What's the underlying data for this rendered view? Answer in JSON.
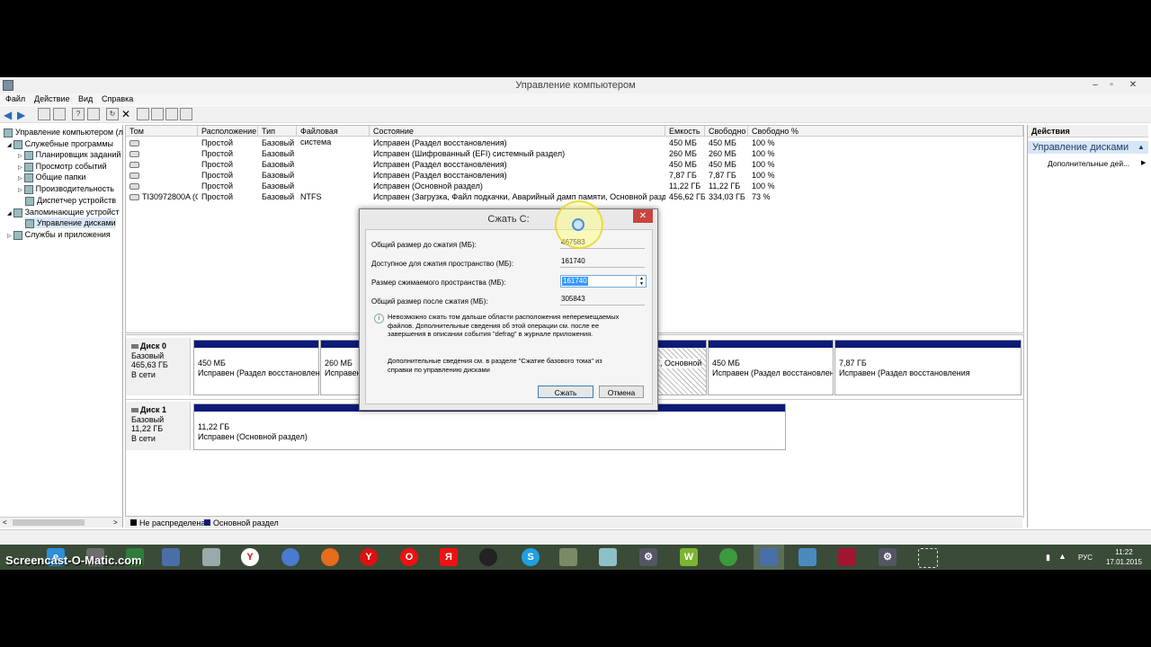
{
  "window": {
    "title": "Управление компьютером",
    "controls": [
      "–",
      "▫",
      "✕"
    ]
  },
  "menu": [
    "Файл",
    "Действие",
    "Вид",
    "Справка"
  ],
  "tree": [
    {
      "label": "Управление компьютером (л",
      "indent": 0,
      "expander": ""
    },
    {
      "label": "Служебные программы",
      "indent": 1,
      "expander": "◢"
    },
    {
      "label": "Планировщик заданий",
      "indent": 2,
      "expander": "▷"
    },
    {
      "label": "Просмотр событий",
      "indent": 2,
      "expander": "▷"
    },
    {
      "label": "Общие папки",
      "indent": 2,
      "expander": "▷"
    },
    {
      "label": "Производительность",
      "indent": 2,
      "expander": "▷"
    },
    {
      "label": "Диспетчер устройств",
      "indent": 2,
      "expander": ""
    },
    {
      "label": "Запоминающие устройст",
      "indent": 1,
      "expander": "◢"
    },
    {
      "label": "Управление дисками",
      "indent": 2,
      "expander": ""
    },
    {
      "label": "Службы и приложения",
      "indent": 1,
      "expander": "▷"
    }
  ],
  "volumes": {
    "columns": [
      "Том",
      "Расположение",
      "Тип",
      "Файловая система",
      "Состояние",
      "Емкость",
      "Свободно",
      "Свободно %"
    ],
    "rows": [
      [
        "",
        "Простой",
        "Базовый",
        "",
        "Исправен (Раздел восстановления)",
        "450 МБ",
        "450 МБ",
        "100 %"
      ],
      [
        "",
        "Простой",
        "Базовый",
        "",
        "Исправен (Шифрованный (EFI) системный раздел)",
        "260 МБ",
        "260 МБ",
        "100 %"
      ],
      [
        "",
        "Простой",
        "Базовый",
        "",
        "Исправен (Раздел восстановления)",
        "450 МБ",
        "450 МБ",
        "100 %"
      ],
      [
        "",
        "Простой",
        "Базовый",
        "",
        "Исправен (Раздел восстановления)",
        "7,87 ГБ",
        "7,87 ГБ",
        "100 %"
      ],
      [
        "",
        "Простой",
        "Базовый",
        "",
        "Исправен (Основной раздел)",
        "11,22 ГБ",
        "11,22 ГБ",
        "100 %"
      ],
      [
        "TI30972800A (C:)",
        "Простой",
        "Базовый",
        "NTFS",
        "Исправен (Загрузка, Файл подкачки, Аварийный дамп памяти, Основной раздел)",
        "456,62 ГБ",
        "334,03 ГБ",
        "73 %"
      ]
    ]
  },
  "disks": [
    {
      "name": "Диск 0",
      "type": "Базовый",
      "size": "465,63 ГБ",
      "status": "В сети"
    },
    {
      "name": "Диск 1",
      "type": "Базовый",
      "size": "11,22 ГБ",
      "status": "В сети"
    }
  ],
  "partitions": {
    "d0p1": {
      "size": "450 МБ",
      "state": "Исправен (Раздел восстановлени"
    },
    "d0p2": {
      "size": "260 МБ",
      "state": "Исправен ("
    },
    "d0p3": {
      "size": "",
      "state": ", Основной"
    },
    "d0p4": {
      "size": "450 МБ",
      "state": "Исправен (Раздел восстановлени"
    },
    "d0p5": {
      "size": "7,87 ГБ",
      "state": "Исправен (Раздел восстановления"
    },
    "d1p1": {
      "size": "11,22 ГБ",
      "state": "Исправен (Основной раздел)"
    }
  },
  "legend": [
    "Не распределена",
    "Основной раздел"
  ],
  "colors": {
    "unallocated": "#000000",
    "primary": "#0c1a78",
    "close": "#c7453e",
    "highlight": "#3399ff"
  },
  "actions": {
    "header": "Действия",
    "section": "Управление дисками",
    "item": "Дополнительные дей..."
  },
  "dialog": {
    "title": "Сжать C:",
    "total_before_label": "Общий размер до сжатия (МБ):",
    "total_before": "467583",
    "available_label": "Доступное для сжатия пространство (МБ):",
    "available": "161740",
    "shrink_label": "Размер сжимаемого пространства (МБ):",
    "shrink_value": "161740",
    "total_after_label": "Общий размер после сжатия (МБ):",
    "total_after": "305843",
    "info": "Невозможно сжать том дальше области расположения неперемещаемых файлов. Дополнительные сведения об этой операции см. после ее завершения в описании события \"defrag\" в журнале приложения.",
    "more_info": "Дополнительные сведения см. в разделе \"Сжатие базового тома\" из справки по управлению дисками",
    "ok": "Сжать",
    "cancel": "Отмена"
  },
  "taskbar": {
    "watermark": "Screencast-O-Matic.com",
    "lang": "РУС",
    "time": "11:22",
    "date": "17.01.2015",
    "icons": [
      "ie-icon",
      "yandex-browser-icon",
      "globe-icon",
      "firefox-icon",
      "yandex-icon",
      "opera-icon",
      "yandex-search-icon",
      "media-icon",
      "skype-icon",
      "paint-icon",
      "notepad-icon",
      "settings-icon",
      "winrar-icon",
      "network-icon",
      "computer-management-icon",
      "remote-desktop-icon",
      "presentation-icon",
      "gear-icon",
      "snipping-tool-icon"
    ]
  }
}
